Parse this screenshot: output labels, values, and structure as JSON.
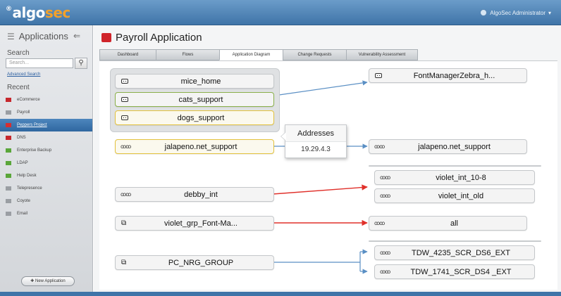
{
  "header": {
    "logo_sup": "®",
    "logo_algo": "algo",
    "logo_sec": "sec",
    "user": "AlgoSec Administrator"
  },
  "sidebar": {
    "title": "Applications",
    "search_label": "Search",
    "search_placeholder": "Search...",
    "advanced_search": "Advanced Search",
    "recent_label": "Recent",
    "items": [
      {
        "label": "eCommerce",
        "color": "#c6282d"
      },
      {
        "label": "Payroll",
        "color": "#9a9ea3"
      },
      {
        "label": "Peppers Project",
        "color": "#d62f31"
      },
      {
        "label": "DNS",
        "color": "#c6282d"
      },
      {
        "label": "Enterprise Backup",
        "color": "#5aa63a"
      },
      {
        "label": "LDAP",
        "color": "#5aa63a"
      },
      {
        "label": "Help Desk",
        "color": "#5aa63a"
      },
      {
        "label": "Telepresence",
        "color": "#9a9ea3"
      },
      {
        "label": "Coyote",
        "color": "#9a9ea3"
      },
      {
        "label": "Email",
        "color": "#9a9ea3"
      }
    ],
    "new_app": "New Application"
  },
  "app": {
    "title": "Payroll Application",
    "title_color": "#d0252b"
  },
  "tabs": [
    {
      "label": "Dashboard"
    },
    {
      "label": "Flows"
    },
    {
      "label": "Application Diagram"
    },
    {
      "label": "Change Requests"
    },
    {
      "label": "Vulnerability Assessment"
    }
  ],
  "diagram": {
    "sources": {
      "mice_home": "mice_home",
      "cats_support": "cats_support",
      "dogs_support": "dogs_support",
      "jalapeno_src": "jalapeno.net_support",
      "debby": "debby_int",
      "violet_grp": "violet_grp_Font-Ma...",
      "pc_nrg": "PC_NRG_GROUP"
    },
    "destinations": {
      "fontmanager": "FontManagerZebra_h...",
      "jalapeno_dst": "jalapeno.net_support",
      "violet_10_8": "violet_int_10-8",
      "violet_old": "violet_int_old",
      "all": "all",
      "tdw_4235": "TDW_4235_SCR_DS6_EXT",
      "tdw_1741": "TDW_1741_SCR_DS4 _EXT"
    },
    "popup": {
      "title": "Addresses",
      "value": "19.29.4.3"
    },
    "colors": {
      "allowed": "#5a8fc4",
      "blocked": "#e0302a",
      "selected_border": "#e3c23e",
      "highlight_border": "#8ab04a"
    }
  }
}
